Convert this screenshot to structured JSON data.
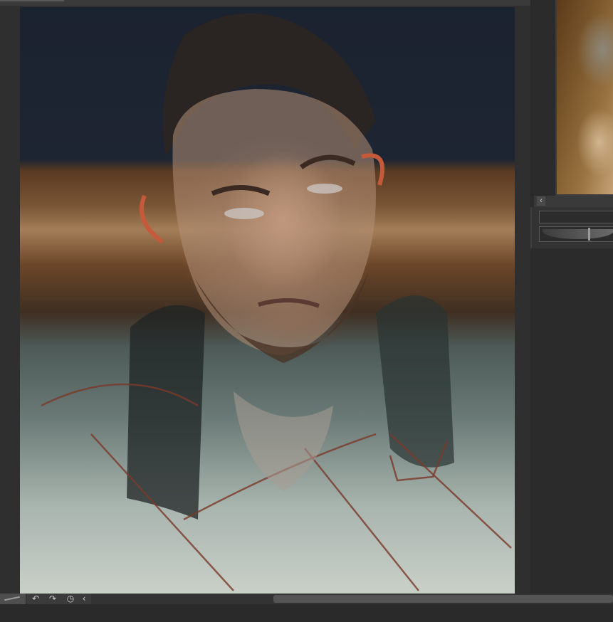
{
  "canvas": {
    "artwork": "painted-portrait-bearded-man-mohawk"
  },
  "reference_panel": {
    "image": "reference-painting-old-man",
    "nav_left_glyph": "‹"
  },
  "toolbar": {
    "undo_glyph": "↶",
    "redo_glyph": "↷",
    "history_glyph": "◷",
    "collapse_glyph": "‹"
  },
  "colors": {
    "ui_background": "#2b2b2b",
    "panel": "#3a3a3a",
    "scroll_thumb": "#555555"
  }
}
